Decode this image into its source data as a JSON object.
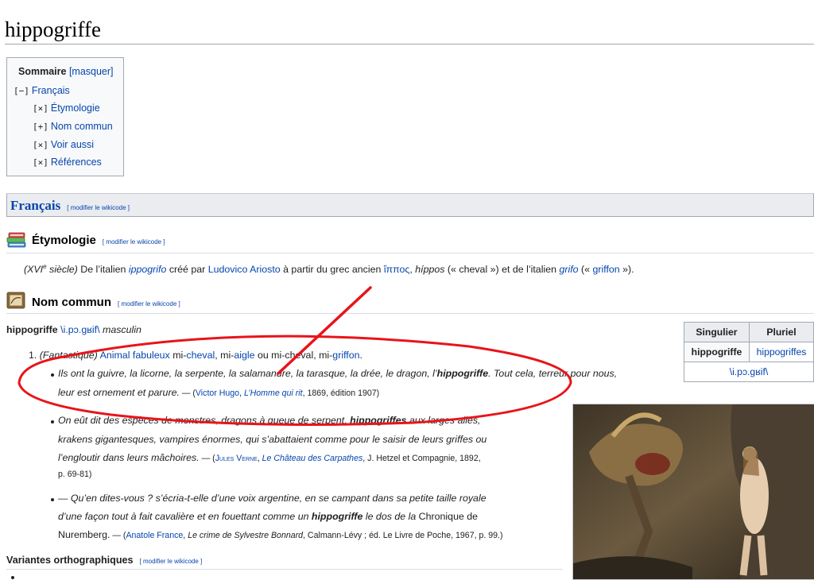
{
  "page": {
    "title": "hippogriffe"
  },
  "toc": {
    "title": "Sommaire",
    "toggle": "[masquer]",
    "items": [
      {
        "mark": "[−]",
        "label": "Français"
      },
      {
        "mark": "[×]",
        "label": "Étymologie"
      },
      {
        "mark": "[+]",
        "label": "Nom commun"
      },
      {
        "mark": "[×]",
        "label": "Voir aussi"
      },
      {
        "mark": "[×]",
        "label": "Références"
      }
    ]
  },
  "francais": {
    "heading": "Français",
    "edit": "[ modifier le wikicode ]"
  },
  "etymology": {
    "heading": "Étymologie",
    "edit": "[ modifier le wikicode ]",
    "century": "(XVI",
    "century_sup": "e",
    "century_end": " siècle)",
    "t1": " De l’italien ",
    "l1": "ippogrifo",
    "t2": " créé par ",
    "l2": "Ludovico Ariosto",
    "t3": " à partir du grec ancien ",
    "l3": "ἵππος",
    "t4": ", ",
    "l4": "híppos",
    "t5": " (« cheval ») et de l’italien ",
    "l5": "grifo",
    "t6": " (« ",
    "l6": "griffon",
    "t7": " »)."
  },
  "noun": {
    "heading": "Nom commun",
    "edit": "[ modifier le wikicode ]",
    "headword": "hippogriffe",
    "pron": "\\i.pɔ.ɡʁif\\",
    "gender": "masculin",
    "def_num": "1.",
    "def_domain": "(Fantastique)",
    "def_l1": "Animal fabuleux",
    "def_t1": " mi-",
    "def_l2": "cheval",
    "def_t2": ", mi-",
    "def_l3": "aigle",
    "def_t3": " ou mi-cheval, mi-",
    "def_l4": "griffon",
    "def_t4": "."
  },
  "quotes": {
    "q1_a": "Ils ont la guivre, la licorne, la serpente, la salamandre, la tarasque, la drée, le dragon, l’",
    "q1_b": "hippogriffe",
    "q1_c": ". Tout cela, terreur pour nous,",
    "q1_d": "leur est ornement et parure.",
    "q1_src_a": " — (",
    "q1_author": "Victor Hugo",
    "q1_sep": ", ",
    "q1_work": "L’Homme qui rit",
    "q1_rest": ", 1869, édition 1907)",
    "q2_a": "On eût dit des espèces de monstres, dragons à queue de serpent, ",
    "q2_b": "hippogriffes",
    "q2_c": " aux larges ailes,",
    "q2_d": "krakens gigantesques, vampires énormes, qui s’abattaient comme pour le saisir de leurs griffes ou",
    "q2_e": "l’engloutir dans leurs mâchoires.",
    "q2_src_a": " — (",
    "q2_author": "Jules Verne",
    "q2_sep": ", ",
    "q2_work": "Le Château des Carpathes",
    "q2_rest": ", J. Hetzel et Compagnie, 1892,",
    "q2_pages": "p. 69-81)",
    "q3_a": "— Qu’en dites-vous ? s’écria-t-elle d’une voix argentine, en se campant dans sa petite taille royale",
    "q3_b": "d’une façon tout à fait cavalière et en fouettant comme un ",
    "q3_c": "hippogriffe",
    "q3_d": " le dos de la ",
    "q3_e": "Chronique de",
    "q3_f": "Nuremberg.",
    "q3_src_a": " — (",
    "q3_author": "Anatole France",
    "q3_sep": ", ",
    "q3_work": "Le crime de Sylvestre Bonnard",
    "q3_rest": ", Calmann-Lévy ; éd. Le Livre de Poche, 1967, p. 99.)"
  },
  "variants": {
    "heading": "Variantes orthographiques",
    "edit": "[ modifier le wikicode ]"
  },
  "inflection": {
    "col_sing": "Singulier",
    "col_plur": "Pluriel",
    "sing": "hippogriffe",
    "plur": "hippogriffes",
    "pron": "\\i.pɔ.ɡʁif\\"
  },
  "colors": {
    "link": "#0645ad",
    "annotation": "#e8141a",
    "header_bg": "#eaecf0"
  }
}
